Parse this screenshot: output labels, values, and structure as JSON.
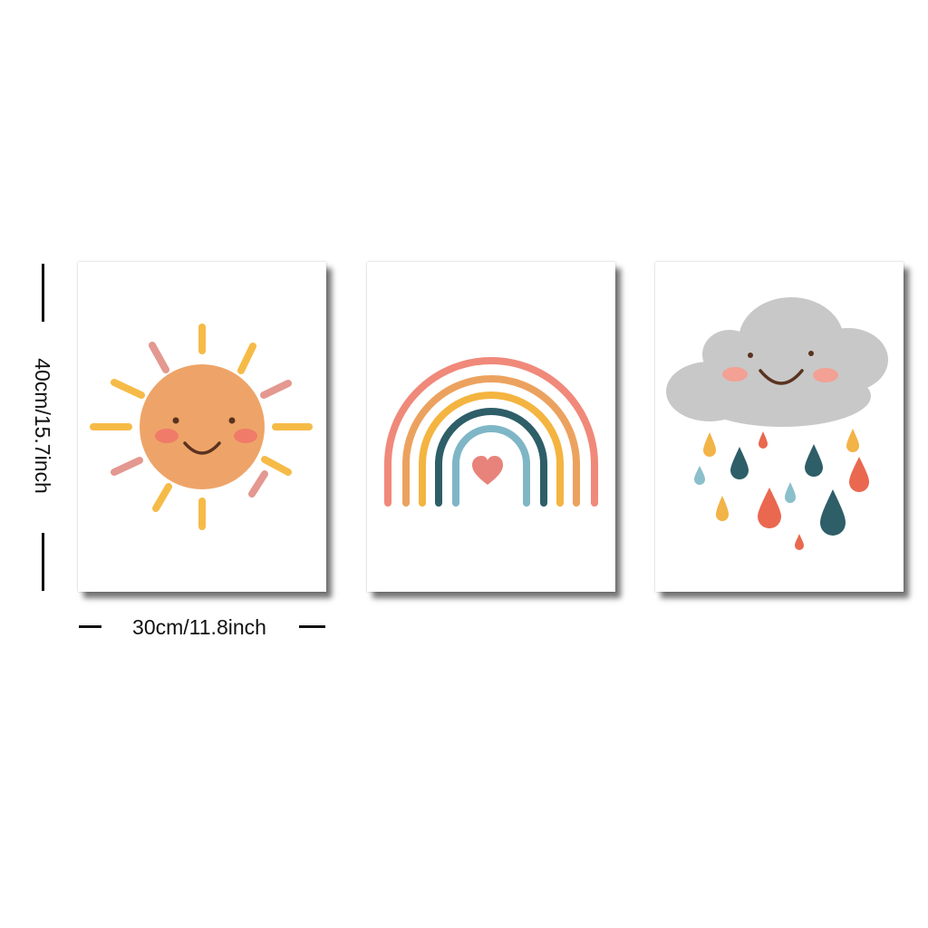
{
  "dimensions": {
    "height_label": "40cm/15.7inch",
    "width_label": "30cm/11.8inch"
  },
  "posters": [
    {
      "subject": "smiling-sun",
      "icon": "sun-icon"
    },
    {
      "subject": "rainbow-with-heart",
      "icon": "rainbow-icon"
    },
    {
      "subject": "smiling-rain-cloud",
      "icon": "cloud-icon"
    }
  ],
  "palette": {
    "sun": "#EEA468",
    "ray_yellow": "#F6BB47",
    "ray_pink": "#E39890",
    "cheek": "#F07B69",
    "mouth": "#5A3220",
    "rainbow_coral": "#F0897A",
    "rainbow_orange": "#ECA25F",
    "rainbow_yellow": "#F4B440",
    "rainbow_teal": "#2E5E68",
    "rainbow_blue": "#7FB6C6",
    "heart": "#E7837A",
    "cloud": "#C8C8C8",
    "drop_teal": "#2E5E68",
    "drop_red": "#E9684F",
    "drop_yellow": "#F2B347",
    "drop_blue": "#8BBFCB"
  }
}
